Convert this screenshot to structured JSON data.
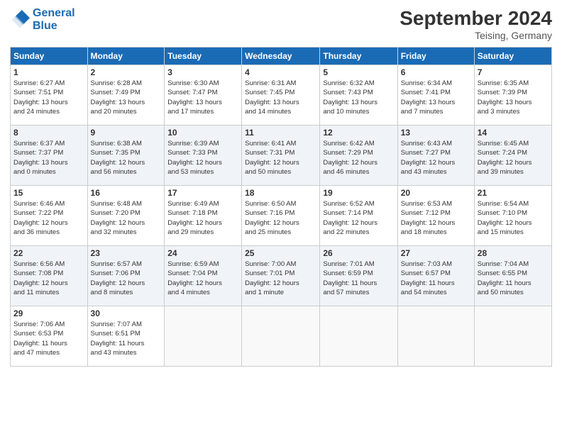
{
  "header": {
    "logo_line1": "General",
    "logo_line2": "Blue",
    "month_title": "September 2024",
    "location": "Teising, Germany"
  },
  "weekdays": [
    "Sunday",
    "Monday",
    "Tuesday",
    "Wednesday",
    "Thursday",
    "Friday",
    "Saturday"
  ],
  "weeks": [
    [
      {
        "day": "1",
        "sunrise": "6:27 AM",
        "sunset": "7:51 PM",
        "daylight": "13 hours and 24 minutes."
      },
      {
        "day": "2",
        "sunrise": "6:28 AM",
        "sunset": "7:49 PM",
        "daylight": "13 hours and 20 minutes."
      },
      {
        "day": "3",
        "sunrise": "6:30 AM",
        "sunset": "7:47 PM",
        "daylight": "13 hours and 17 minutes."
      },
      {
        "day": "4",
        "sunrise": "6:31 AM",
        "sunset": "7:45 PM",
        "daylight": "13 hours and 14 minutes."
      },
      {
        "day": "5",
        "sunrise": "6:32 AM",
        "sunset": "7:43 PM",
        "daylight": "13 hours and 10 minutes."
      },
      {
        "day": "6",
        "sunrise": "6:34 AM",
        "sunset": "7:41 PM",
        "daylight": "13 hours and 7 minutes."
      },
      {
        "day": "7",
        "sunrise": "6:35 AM",
        "sunset": "7:39 PM",
        "daylight": "13 hours and 3 minutes."
      }
    ],
    [
      {
        "day": "8",
        "sunrise": "6:37 AM",
        "sunset": "7:37 PM",
        "daylight": "13 hours and 0 minutes."
      },
      {
        "day": "9",
        "sunrise": "6:38 AM",
        "sunset": "7:35 PM",
        "daylight": "12 hours and 56 minutes."
      },
      {
        "day": "10",
        "sunrise": "6:39 AM",
        "sunset": "7:33 PM",
        "daylight": "12 hours and 53 minutes."
      },
      {
        "day": "11",
        "sunrise": "6:41 AM",
        "sunset": "7:31 PM",
        "daylight": "12 hours and 50 minutes."
      },
      {
        "day": "12",
        "sunrise": "6:42 AM",
        "sunset": "7:29 PM",
        "daylight": "12 hours and 46 minutes."
      },
      {
        "day": "13",
        "sunrise": "6:43 AM",
        "sunset": "7:27 PM",
        "daylight": "12 hours and 43 minutes."
      },
      {
        "day": "14",
        "sunrise": "6:45 AM",
        "sunset": "7:24 PM",
        "daylight": "12 hours and 39 minutes."
      }
    ],
    [
      {
        "day": "15",
        "sunrise": "6:46 AM",
        "sunset": "7:22 PM",
        "daylight": "12 hours and 36 minutes."
      },
      {
        "day": "16",
        "sunrise": "6:48 AM",
        "sunset": "7:20 PM",
        "daylight": "12 hours and 32 minutes."
      },
      {
        "day": "17",
        "sunrise": "6:49 AM",
        "sunset": "7:18 PM",
        "daylight": "12 hours and 29 minutes."
      },
      {
        "day": "18",
        "sunrise": "6:50 AM",
        "sunset": "7:16 PM",
        "daylight": "12 hours and 25 minutes."
      },
      {
        "day": "19",
        "sunrise": "6:52 AM",
        "sunset": "7:14 PM",
        "daylight": "12 hours and 22 minutes."
      },
      {
        "day": "20",
        "sunrise": "6:53 AM",
        "sunset": "7:12 PM",
        "daylight": "12 hours and 18 minutes."
      },
      {
        "day": "21",
        "sunrise": "6:54 AM",
        "sunset": "7:10 PM",
        "daylight": "12 hours and 15 minutes."
      }
    ],
    [
      {
        "day": "22",
        "sunrise": "6:56 AM",
        "sunset": "7:08 PM",
        "daylight": "12 hours and 11 minutes."
      },
      {
        "day": "23",
        "sunrise": "6:57 AM",
        "sunset": "7:06 PM",
        "daylight": "12 hours and 8 minutes."
      },
      {
        "day": "24",
        "sunrise": "6:59 AM",
        "sunset": "7:04 PM",
        "daylight": "12 hours and 4 minutes."
      },
      {
        "day": "25",
        "sunrise": "7:00 AM",
        "sunset": "7:01 PM",
        "daylight": "12 hours and 1 minute."
      },
      {
        "day": "26",
        "sunrise": "7:01 AM",
        "sunset": "6:59 PM",
        "daylight": "11 hours and 57 minutes."
      },
      {
        "day": "27",
        "sunrise": "7:03 AM",
        "sunset": "6:57 PM",
        "daylight": "11 hours and 54 minutes."
      },
      {
        "day": "28",
        "sunrise": "7:04 AM",
        "sunset": "6:55 PM",
        "daylight": "11 hours and 50 minutes."
      }
    ],
    [
      {
        "day": "29",
        "sunrise": "7:06 AM",
        "sunset": "6:53 PM",
        "daylight": "11 hours and 47 minutes."
      },
      {
        "day": "30",
        "sunrise": "7:07 AM",
        "sunset": "6:51 PM",
        "daylight": "11 hours and 43 minutes."
      },
      null,
      null,
      null,
      null,
      null
    ]
  ]
}
